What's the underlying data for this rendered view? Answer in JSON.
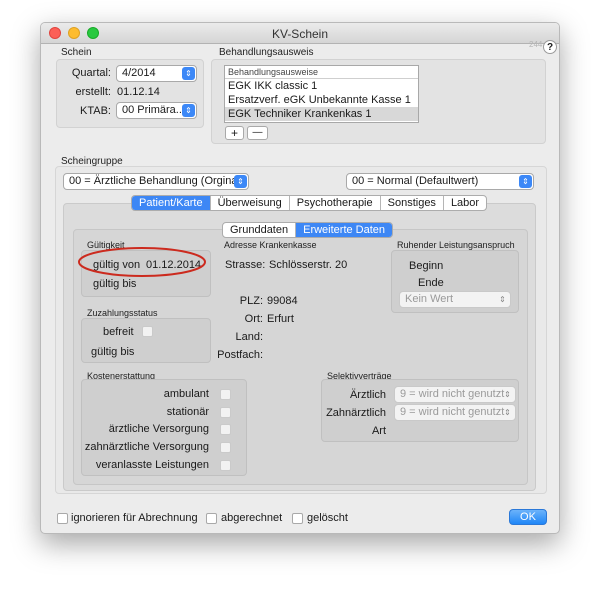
{
  "window": {
    "title": "KV-Schein",
    "version": "244",
    "help": "?"
  },
  "schein": {
    "title": "Schein",
    "quartal_label": "Quartal:",
    "quartal_value": "4/2014",
    "erstellt_label": "erstellt:",
    "erstellt_value": "01.12.14",
    "ktab_label": "KTAB:",
    "ktab_value": "00 Primära..."
  },
  "behandlungsausweis": {
    "title": "Behandlungsausweis",
    "list_header": "Behandlungsausweise",
    "items": [
      {
        "label": "EGK IKK classic 1"
      },
      {
        "label": "Ersatzverf. eGK Unbekannte Kasse 1"
      },
      {
        "label": "EGK Techniker Krankenkas 1"
      }
    ],
    "add": "+",
    "remove": "—"
  },
  "scheingruppe": {
    "title": "Scheingruppe",
    "left_value": "00 = Ärztliche Behandlung (Orgina...",
    "right_value": "00 = Normal (Defaultwert)"
  },
  "tabs": [
    "Patient/Karte",
    "Überweisung",
    "Psychotherapie",
    "Sonstiges",
    "Labor"
  ],
  "subtabs": [
    "Grunddaten",
    "Erweiterte Daten"
  ],
  "gueltigkeit": {
    "title": "Gültigkeit",
    "von_label": "gültig von",
    "von_value": "01.12.2014",
    "bis_label": "gültig bis"
  },
  "adresse": {
    "title": "Adresse Krankenkasse",
    "strasse_label": "Strasse:",
    "strasse_value": "Schlösserstr. 20",
    "plz_label": "PLZ:",
    "plz_value": "99084",
    "ort_label": "Ort:",
    "ort_value": "Erfurt",
    "land_label": "Land:",
    "postfach_label": "Postfach:"
  },
  "ruhender": {
    "title": "Ruhender Leistungsanspruch",
    "beginn": "Beginn",
    "ende": "Ende",
    "kein_wert": "Kein Wert"
  },
  "zuzahlung": {
    "title": "Zuzahlungsstatus",
    "befreit": "befreit",
    "bis": "gültig bis"
  },
  "kostenerstattung": {
    "title": "Kostenerstattung",
    "items": [
      "ambulant",
      "stationär",
      "ärztliche Versorgung",
      "zahnärztliche Versorgung",
      "veranlasste Leistungen"
    ]
  },
  "selektiv": {
    "title": "Selektivverträge",
    "aerztlich_label": "Ärztlich",
    "aerztlich_value": "9 = wird nicht genutzt",
    "zahn_label": "Zahnärztlich",
    "zahn_value": "9 = wird nicht genutzt",
    "art_label": "Art"
  },
  "bottom": {
    "ignorieren": "ignorieren für Abrechnung",
    "abgerechnet": "abgerechnet",
    "geloescht": "gelöscht",
    "ok": "OK"
  },
  "colors": {
    "accent": "#3d87f5",
    "highlight_ellipse": "#cc2a1e",
    "window_bg": "#ececec"
  }
}
